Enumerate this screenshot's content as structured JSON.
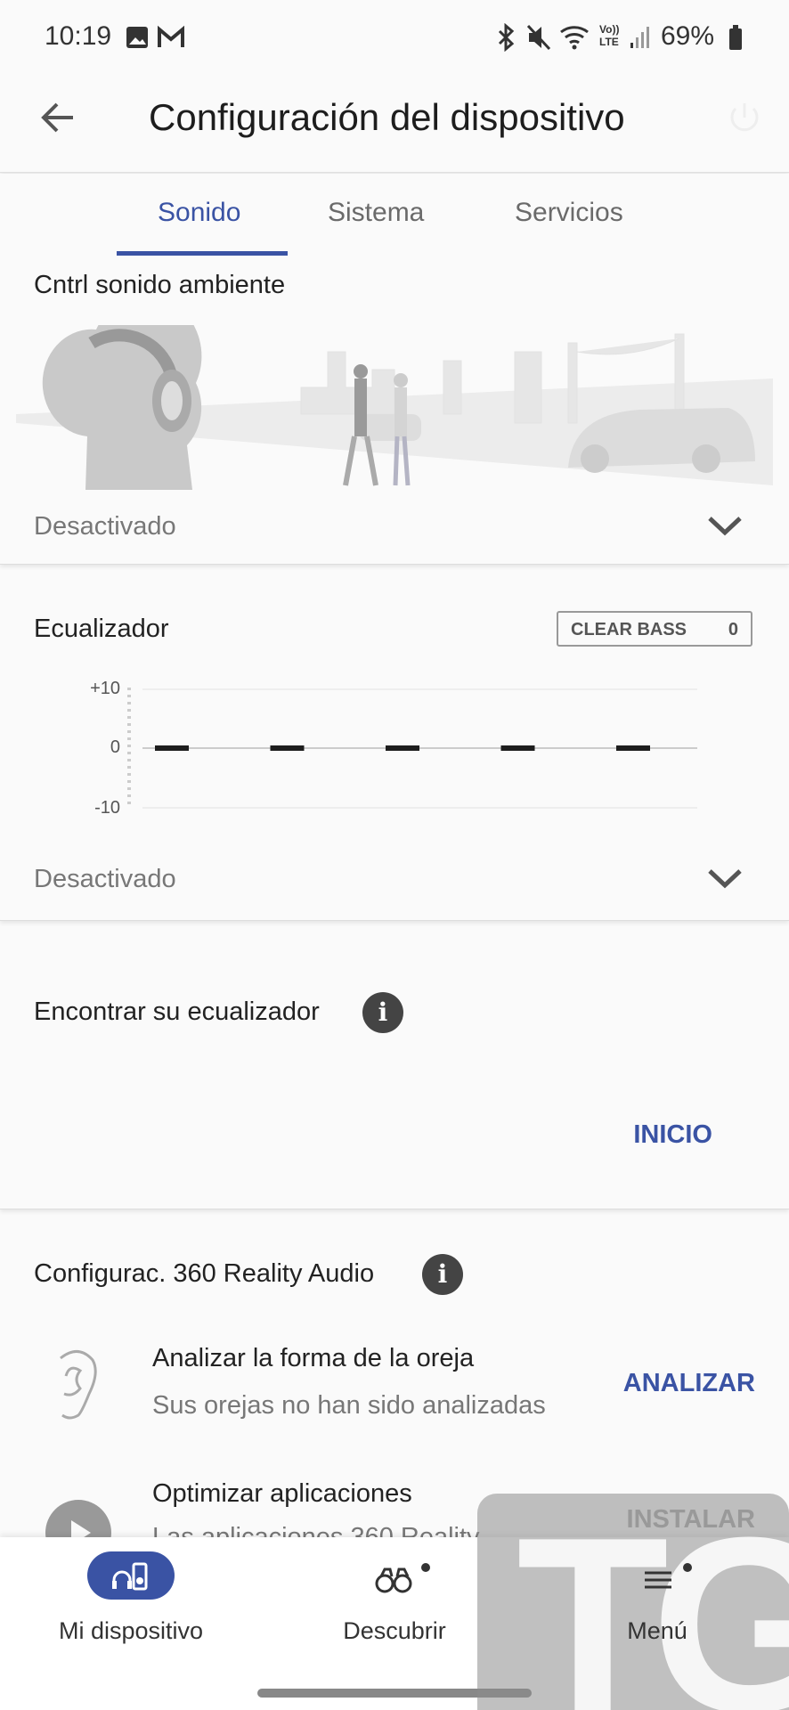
{
  "status_bar": {
    "time": "10:19",
    "battery": "69%",
    "icons": [
      "image-icon",
      "gmail-icon",
      "bluetooth-icon",
      "mute-icon",
      "wifi-icon",
      "volte-icon",
      "signal-icon",
      "battery-icon"
    ],
    "volte": "Vo)) LTE"
  },
  "header": {
    "title": "Configuración del dispositivo",
    "back_icon": "arrow-left-icon",
    "power_icon": "power-icon"
  },
  "tabs": [
    {
      "label": "Sonido",
      "active": true
    },
    {
      "label": "Sistema"
    },
    {
      "label": "Servicios"
    }
  ],
  "ambient": {
    "title": "Cntrl sonido ambiente",
    "status": "Desactivado"
  },
  "equalizer": {
    "title": "Ecualizador",
    "clear_bass_label": "CLEAR BASS",
    "clear_bass_value": "0",
    "status": "Desactivado",
    "chart_data": {
      "type": "bar",
      "y_ticks": [
        "+10",
        "0",
        "-10"
      ],
      "ylim": [
        -10,
        10
      ],
      "values": [
        0,
        0,
        0,
        0,
        0
      ]
    }
  },
  "find_eq": {
    "title": "Encontrar su ecualizador",
    "button": "INICIO"
  },
  "reality360": {
    "title": "Configurac. 360 Reality Audio",
    "items": [
      {
        "title": "Analizar la forma de la oreja",
        "subtitle": "Sus orejas no han sido analizadas",
        "button": "ANALIZAR",
        "icon": "ear-icon"
      },
      {
        "title": "Optimizar aplicaciones",
        "subtitle": "Las aplicaciones 360 Reality",
        "button": "INSTALAR",
        "icon": "play-icon"
      }
    ]
  },
  "bottom_nav": [
    {
      "label": "Mi dispositivo",
      "active": true
    },
    {
      "label": "Descubrir"
    },
    {
      "label": "Menú"
    }
  ],
  "watermark": "TG",
  "colors": {
    "accent": "#3a53a4",
    "background": "#fafafa"
  }
}
